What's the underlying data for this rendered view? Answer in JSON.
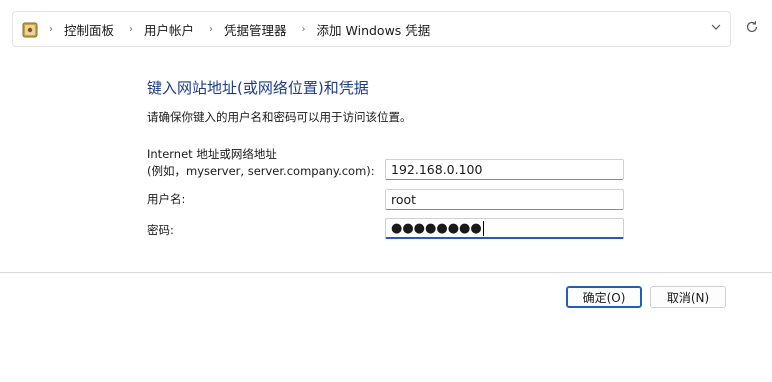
{
  "breadcrumb": {
    "items": [
      "控制面板",
      "用户帐户",
      "凭据管理器",
      "添加 Windows 凭据"
    ],
    "separator": "›"
  },
  "main": {
    "heading": "键入网站地址(或网络位置)和凭据",
    "subtext": "请确保你键入的用户名和密码可以用于访问该位置。",
    "address_label_line1": "Internet 地址或网络地址",
    "address_label_line2": "(例如，myserver, server.company.com):",
    "address_value": "192.168.0.100",
    "username_label": "用户名:",
    "username_value": "root",
    "password_label": "密码:",
    "password_mask": "●●●●●●●●"
  },
  "buttons": {
    "ok_label": "确定(O)",
    "cancel_label": "取消(N)"
  },
  "colors": {
    "heading": "#1e3c8c",
    "accent": "#1f5fb8"
  }
}
